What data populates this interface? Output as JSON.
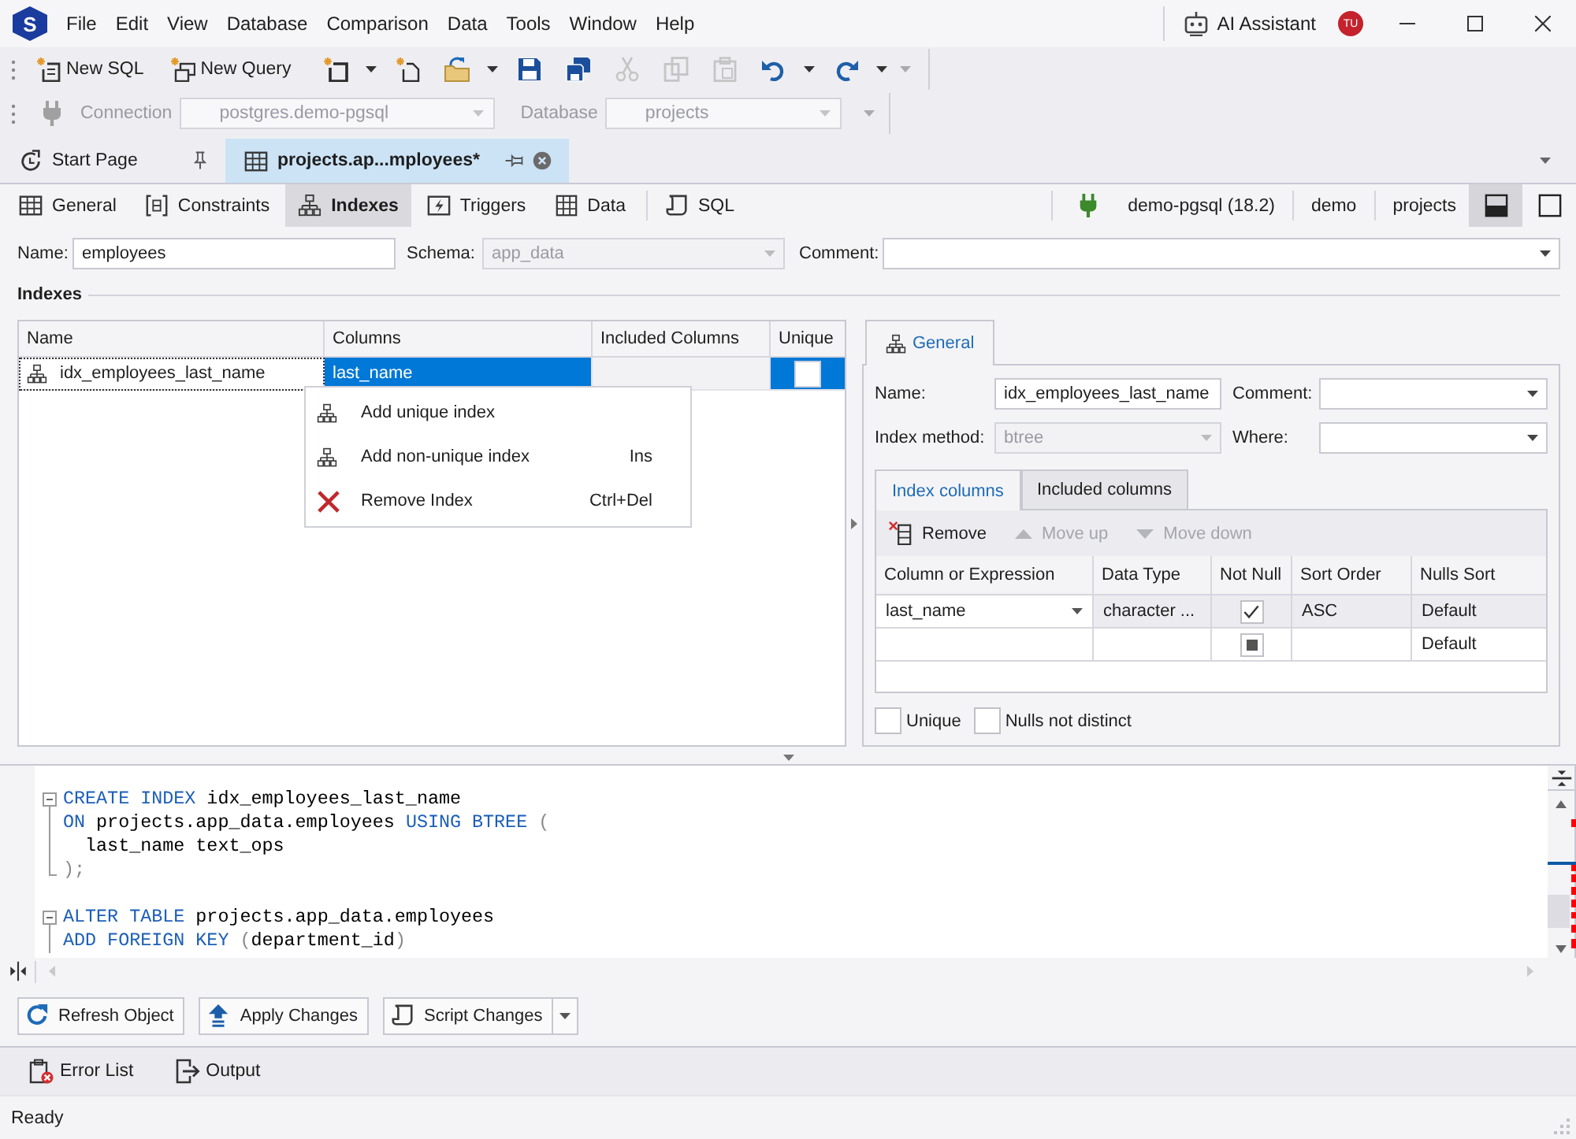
{
  "app_logo": "S",
  "menu_bar": {
    "items": [
      "File",
      "Edit",
      "View",
      "Database",
      "Comparison",
      "Data",
      "Tools",
      "Window",
      "Help"
    ]
  },
  "title_bar": {
    "ai_assistant": "AI Assistant",
    "avatar": "TU"
  },
  "toolbar": {
    "buttons": [
      {
        "label": "New SQL"
      },
      {
        "label": "New Query"
      }
    ],
    "icon_buttons": [
      {
        "dropdown": true,
        "disabled": false
      },
      {
        "dropdown": false,
        "disabled": false
      },
      {
        "dropdown": true,
        "disabled": false
      },
      {
        "dropdown": false,
        "disabled": false
      },
      {
        "dropdown": false,
        "disabled": false
      },
      {
        "dropdown": false,
        "disabled": true
      },
      {
        "dropdown": false,
        "disabled": true
      },
      {
        "dropdown": false,
        "disabled": true
      },
      {
        "dropdown": true,
        "disabled": false
      },
      {
        "dropdown": true,
        "disabled": false
      }
    ]
  },
  "connection_bar": {
    "disabled": true,
    "connection_label": "Connection",
    "connection": "postgres.demo-pgsql",
    "database_label": "Database",
    "database": "projects"
  },
  "document_tabs": [
    {
      "label": "Start Page",
      "selected": false
    },
    {
      "label": "projects.ap...mployees*",
      "selected": true
    }
  ],
  "object_tabs": [
    {
      "label": "General",
      "selected": false
    },
    {
      "label": "Constraints",
      "selected": false
    },
    {
      "label": "Indexes",
      "selected": true
    },
    {
      "label": "Triggers",
      "selected": false
    },
    {
      "label": "Data",
      "selected": false
    },
    {
      "label": "SQL",
      "selected": false
    }
  ],
  "connection_info": [
    "demo-pgsql (18.2)",
    "demo",
    "projects"
  ],
  "layout_buttons": [
    {
      "selected": true
    },
    {
      "selected": false
    }
  ],
  "table_form": {
    "name_label": "Name:",
    "name": "employees",
    "schema_label": "Schema:",
    "schema": "app_data",
    "schema_disabled": true,
    "comment_label": "Comment:"
  },
  "indexes": {
    "title": "Indexes",
    "columns": [
      "Name",
      "Columns",
      "Included Columns",
      "Unique"
    ],
    "rows": [
      {
        "name": "idx_employees_last_name",
        "columns": "last_name",
        "unique": false,
        "selected": true
      }
    ]
  },
  "context_menu": {
    "items": [
      {
        "label": "Add unique index"
      },
      {
        "label": "Add non-unique index",
        "shortcut": "Ins"
      },
      {
        "label": "Remove Index",
        "shortcut": "Ctrl+Del"
      }
    ]
  },
  "index_details": {
    "tabs": [
      {
        "label": "General",
        "selected": true
      }
    ],
    "name_label": "Name:",
    "name": "idx_employees_last_name",
    "comment_label": "Comment:",
    "method_label": "Index method:",
    "method": "btree",
    "method_disabled": true,
    "where_label": "Where:",
    "column_tabs": [
      {
        "label": "Index columns",
        "selected": true
      },
      {
        "label": "Included columns",
        "selected": false
      }
    ],
    "toolbar": [
      {
        "label": "Remove",
        "disabled": false
      },
      {
        "label": "Move up",
        "disabled": true
      },
      {
        "label": "Move down",
        "disabled": true
      }
    ],
    "columns": [
      "Column or Expression",
      "Data Type",
      "Not Null",
      "Sort Order",
      "Nulls Sort"
    ],
    "rows": [
      {
        "column": "last_name",
        "data_type": "character ...",
        "not_null": true,
        "indeterminate": false,
        "sort_order": "ASC",
        "nulls_sort": "Default",
        "selected": true
      },
      {
        "indeterminate": true,
        "nulls_sort": "Default",
        "selected": false
      }
    ],
    "options": [
      {
        "label": "Unique",
        "checked": false
      },
      {
        "label": "Nulls not distinct",
        "checked": false
      }
    ]
  },
  "sql_editor": {
    "statements": [
      {
        "lines": [
          [
            {
              "text": "CREATE INDEX",
              "kind": "keyword"
            },
            {
              "text": " idx_employees_last_name",
              "kind": "plain"
            }
          ],
          [
            {
              "text": "ON",
              "kind": "keyword"
            },
            {
              "text": " projects.app_data.employees ",
              "kind": "plain"
            },
            {
              "text": "USING BTREE",
              "kind": "keyword"
            },
            {
              "text": " (",
              "kind": "punct"
            }
          ],
          [
            {
              "text": "  last_name text_ops",
              "kind": "plain"
            }
          ],
          [
            {
              "text": ");",
              "kind": "punct"
            }
          ]
        ]
      },
      {
        "lines": [
          [
            {
              "text": "ALTER TABLE",
              "kind": "keyword"
            },
            {
              "text": " projects.app_data.employees",
              "kind": "plain"
            }
          ],
          [
            {
              "text": "ADD FOREIGN KEY",
              "kind": "keyword"
            },
            {
              "text": " (",
              "kind": "punct"
            },
            {
              "text": "department_id",
              "kind": "plain"
            },
            {
              "text": ")",
              "kind": "punct"
            }
          ]
        ]
      }
    ]
  },
  "actions": [
    {
      "label": "Refresh Object",
      "dropdown": false
    },
    {
      "label": "Apply Changes",
      "dropdown": false
    },
    {
      "label": "Script Changes",
      "dropdown": true
    }
  ],
  "bottom_tabs": [
    "Error List",
    "Output"
  ],
  "status_bar": "Ready"
}
